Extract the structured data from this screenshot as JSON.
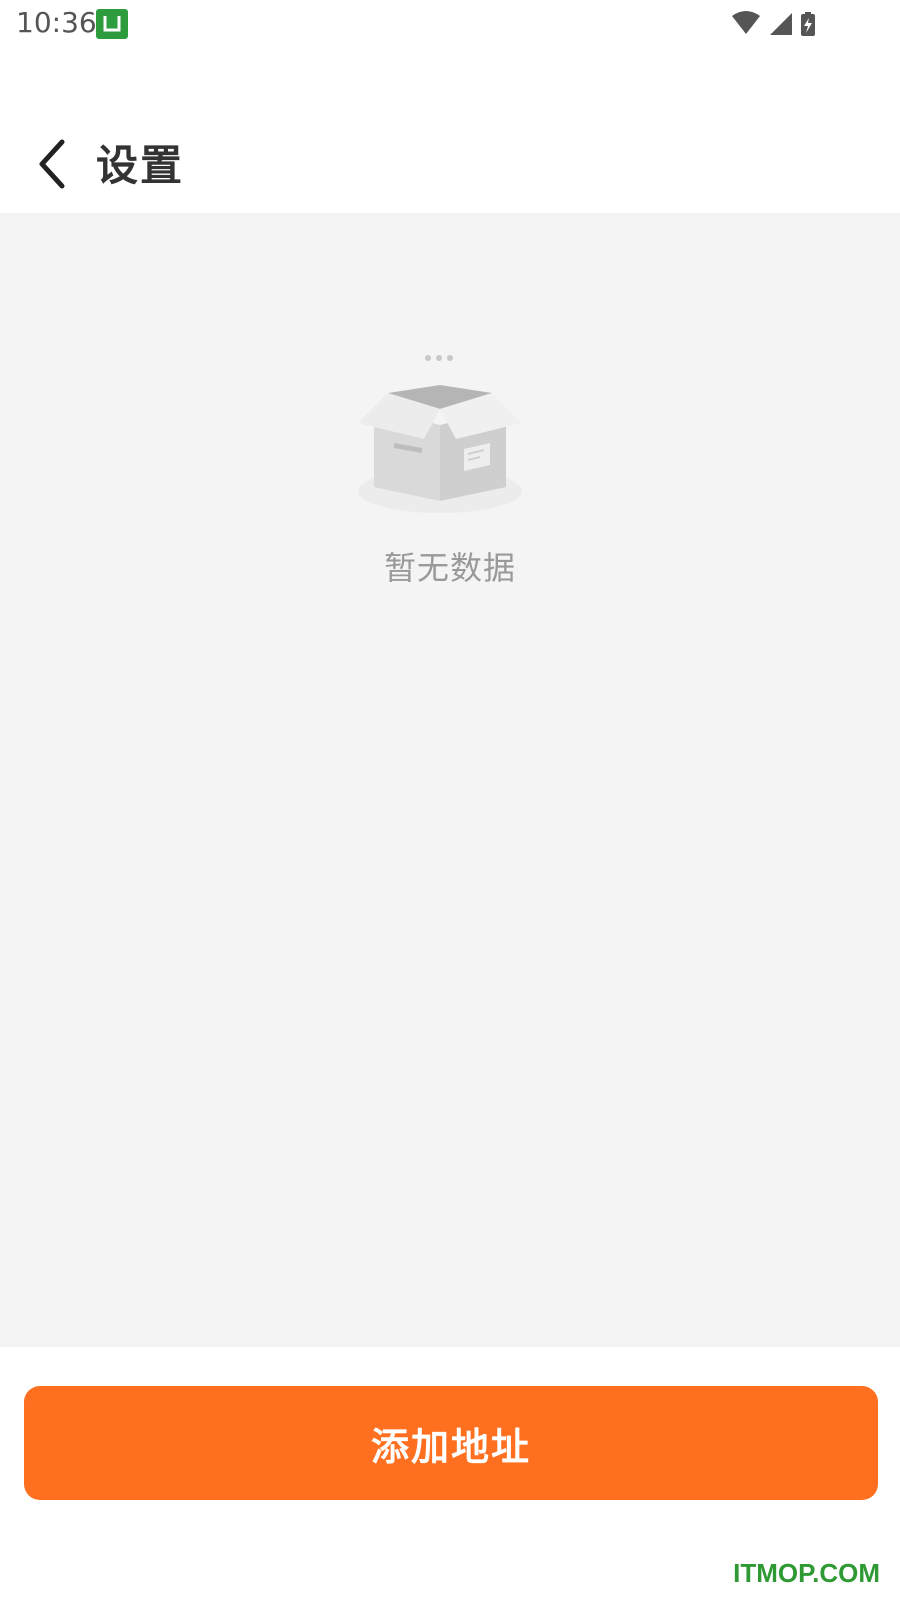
{
  "status_bar": {
    "time": "10:36",
    "app_icon": "app-notification-icon",
    "app_icon_glyph": "U",
    "icons": [
      "wifi-icon",
      "cellular-signal-icon",
      "battery-charging-icon"
    ]
  },
  "header": {
    "back_icon": "chevron-left-icon",
    "title": "设置"
  },
  "empty_state": {
    "icon": "empty-box-icon",
    "message": "暂无数据"
  },
  "footer": {
    "add_address_label": "添加地址"
  },
  "watermark": {
    "text": "ITMOP.COM"
  },
  "colors": {
    "accent": "#ff6f20",
    "background": "#f4f4f4",
    "watermark": "#2f9a34"
  }
}
